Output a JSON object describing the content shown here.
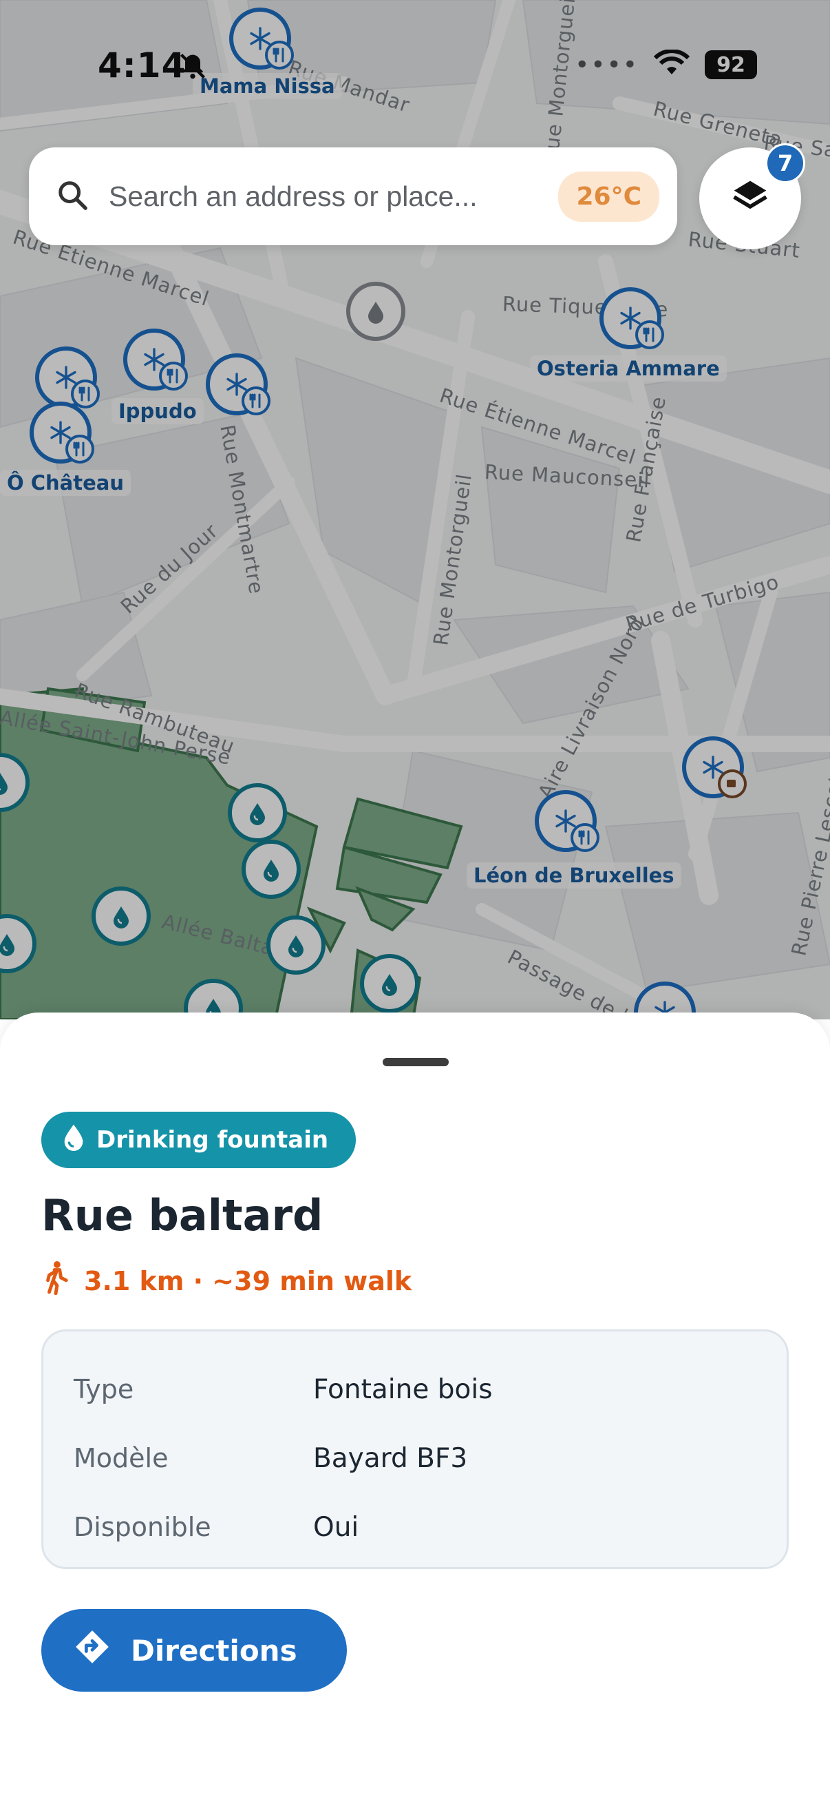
{
  "status_bar": {
    "time": "4:14",
    "battery": "92"
  },
  "search": {
    "placeholder": "Search an address or place...",
    "temperature": "26°C"
  },
  "layers": {
    "badge_count": "7"
  },
  "map": {
    "streets": [
      "Rue Etienne Marcel",
      "Rue Étienne Marcel",
      "Rue Tiquetonne",
      "Rue Mauconseil",
      "Rue Française",
      "Rue Montorgueil",
      "Rue du Jour",
      "Rue de Turbigo",
      "Rue Rambuteau",
      "Allée Saint-John Perse",
      "Rue Greneta",
      "Rue Mandar",
      "Rue Montmartre",
      "Aire Livraison Nord",
      "Allée Baltard",
      "Passage de la Reine de Hongrie",
      "Rue Pierre Lescot",
      "Rue Saint-Sauveur",
      "Rue Stuart",
      "Rue Montorgueil"
    ],
    "places": [
      "Mama Nissa",
      "Osteria Ammare",
      "Ippudo",
      "Ô Château",
      "Léon de Bruxelles"
    ]
  },
  "sheet": {
    "category": "Drinking fountain",
    "title": "Rue baltard",
    "walk": "3.1 km · ~39 min walk",
    "details": [
      {
        "key": "Type",
        "value": "Fontaine bois"
      },
      {
        "key": "Modèle",
        "value": "Bayard BF3"
      },
      {
        "key": "Disponible",
        "value": "Oui"
      }
    ],
    "directions_label": "Directions"
  },
  "colors": {
    "accent": "#1f6fc5",
    "fountain": "#1593a8",
    "walk": "#e25a12",
    "park": "#7fae8c"
  }
}
